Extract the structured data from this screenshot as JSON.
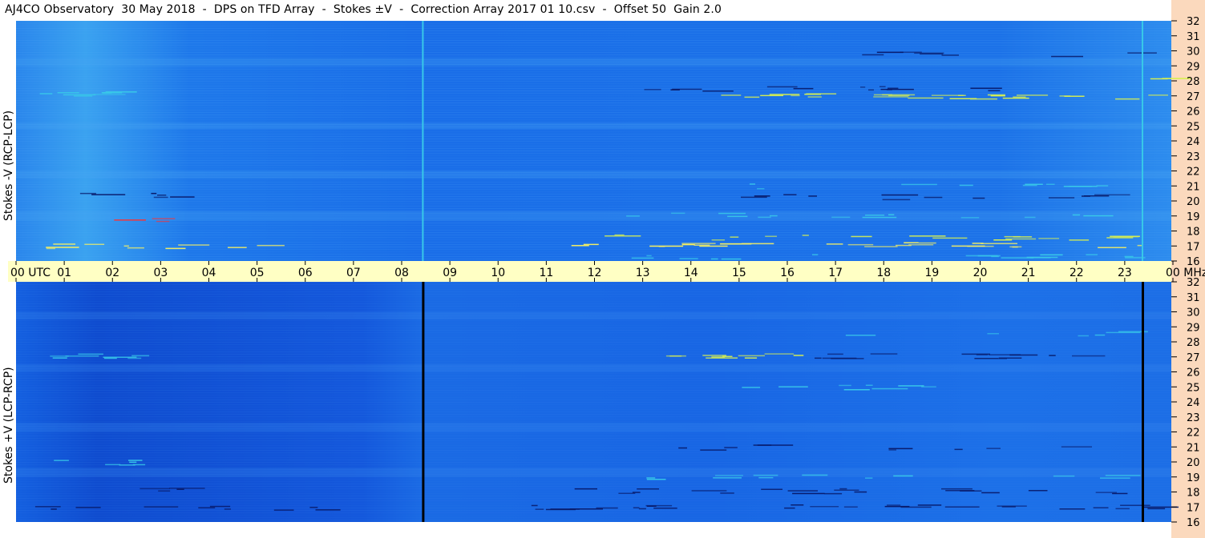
{
  "window": {
    "title": "AJ4CO Observatory  30 May 2018  -  DPS on TFD Array  -  Stokes ±V  -  Correction Array 2017 01 10.csv  -  Offset 50  Gain 2.0"
  },
  "colors": {
    "background_blue": "#1a6ee8",
    "band_light_blue": "#2f8fef",
    "lower_panel_blue": "#1060e0",
    "cyan": "#38c8e8",
    "yellow_green": "#d8f050",
    "yellow": "#f8f060",
    "red": "#ff3030",
    "navy": "#081a6a",
    "time_axis_band": "#ffffc4",
    "freq_axis_band": "#fbd9bd"
  },
  "chart_data": [
    {
      "type": "heatmap",
      "panel": "top",
      "ylabel": "Stokes -V (RCP-LCP)",
      "x_unit": "UTC",
      "x_ticks": [
        "00",
        "01",
        "02",
        "03",
        "04",
        "05",
        "06",
        "07",
        "08",
        "09",
        "10",
        "11",
        "12",
        "13",
        "14",
        "15",
        "16",
        "17",
        "18",
        "19",
        "20",
        "21",
        "22",
        "23",
        "00"
      ],
      "x_first_tick_label": "00  UTC",
      "y_unit": "MHz",
      "y_ticks": [
        16,
        17,
        18,
        19,
        20,
        21,
        22,
        23,
        24,
        25,
        26,
        27,
        28,
        29,
        30,
        31,
        32
      ],
      "ylim": [
        16,
        32
      ],
      "xlim_hours": [
        0,
        24
      ],
      "vertical_lines_hours": [
        8.45,
        23.4
      ],
      "vertical_line_color": "#38c8e8"
    },
    {
      "type": "heatmap",
      "panel": "bottom",
      "ylabel": "Stokes +V (LCP-RCP)",
      "x_unit": "UTC",
      "y_unit": "MHz",
      "y_ticks": [
        16,
        17,
        18,
        19,
        20,
        21,
        22,
        23,
        24,
        25,
        26,
        27,
        28,
        29,
        30,
        31,
        32
      ],
      "ylim": [
        16,
        32
      ],
      "xlim_hours": [
        0,
        24
      ],
      "vertical_lines_hours": [
        8.45,
        23.4
      ],
      "vertical_line_color": "#000000"
    }
  ],
  "axis": {
    "time_last_label": "00 MHz",
    "freq_unit_label": "MHz"
  }
}
